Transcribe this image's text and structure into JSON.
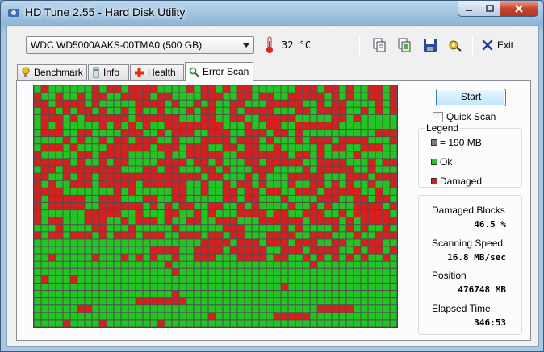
{
  "window": {
    "title": "HD Tune 2.55 - Hard Disk Utility"
  },
  "toolbar": {
    "drive": "WDC WD5000AAKS-00TMA0 (500 GB)",
    "temperature": "32 °C",
    "exit_label": "Exit"
  },
  "tabs": [
    {
      "label": "Benchmark",
      "icon": "benchmark-icon"
    },
    {
      "label": "Info",
      "icon": "info-icon"
    },
    {
      "label": "Health",
      "icon": "health-icon"
    },
    {
      "label": "Error Scan",
      "icon": "error-scan-icon",
      "active": true
    }
  ],
  "controls": {
    "start_label": "Start",
    "quick_scan_label": "Quick Scan",
    "quick_scan_checked": false
  },
  "legend": {
    "title": "Legend",
    "items": [
      {
        "label": "= 190 MB",
        "color": "#7a7a7a"
      },
      {
        "label": "Ok",
        "color": "#22c522"
      },
      {
        "label": "Damaged",
        "color": "#d81f1f"
      }
    ]
  },
  "stats": {
    "damaged_blocks_label": "Damaged Blocks",
    "damaged_blocks_value": "46.5 %",
    "scanning_speed_label": "Scanning Speed",
    "scanning_speed_value": "16.8 MB/sec",
    "position_label": "Position",
    "position_value": "476748 MB",
    "elapsed_label": "Elapsed Time",
    "elapsed_value": "346:53"
  },
  "scan_grid": {
    "columns": 50,
    "rows": 33,
    "colors": {
      "ok": "#22c522",
      "damaged": "#d81f1f",
      "border": "#4e4e4e"
    }
  }
}
